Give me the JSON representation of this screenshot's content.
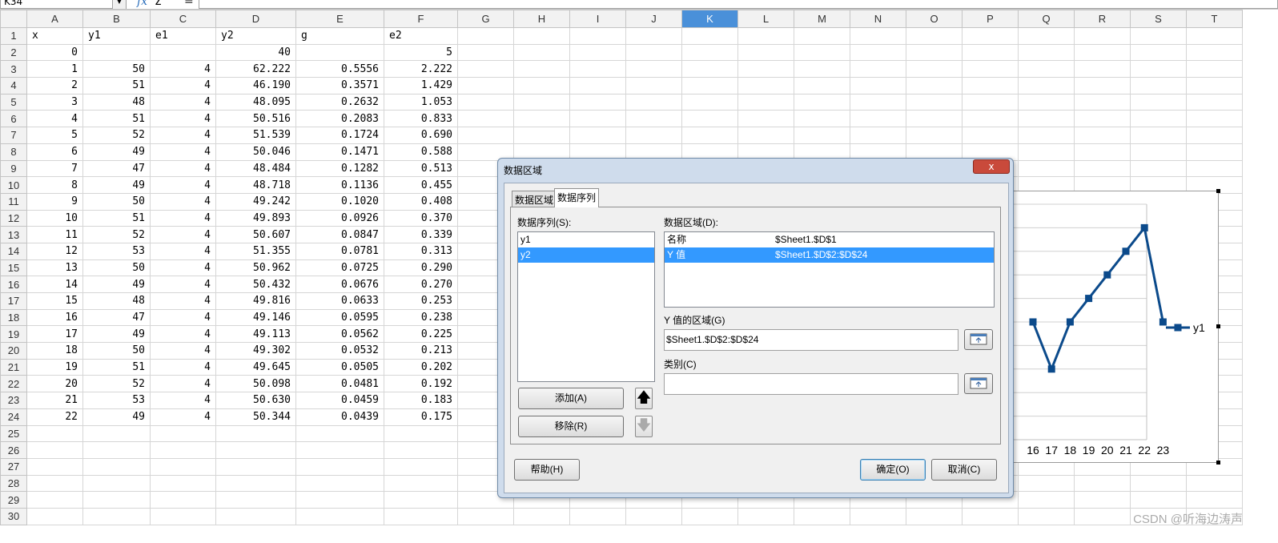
{
  "formula": {
    "cell_ref": "K34",
    "fx": "fx",
    "sum": "Σ",
    "eq": "="
  },
  "sheet": {
    "columns": [
      "A",
      "B",
      "C",
      "D",
      "E",
      "F",
      "G",
      "H",
      "I",
      "J",
      "K",
      "L",
      "M",
      "N",
      "O",
      "P",
      "Q",
      "R",
      "S",
      "T"
    ],
    "active_column": "K",
    "headers": [
      "x",
      "y1",
      "e1",
      "y2",
      "g",
      "e2"
    ],
    "row2": {
      "x": "0",
      "y2": "40",
      "e2": "5"
    },
    "rows": [
      [
        "1",
        "50",
        "4",
        "62.222",
        "0.5556",
        "2.222"
      ],
      [
        "2",
        "51",
        "4",
        "46.190",
        "0.3571",
        "1.429"
      ],
      [
        "3",
        "48",
        "4",
        "48.095",
        "0.2632",
        "1.053"
      ],
      [
        "4",
        "51",
        "4",
        "50.516",
        "0.2083",
        "0.833"
      ],
      [
        "5",
        "52",
        "4",
        "51.539",
        "0.1724",
        "0.690"
      ],
      [
        "6",
        "49",
        "4",
        "50.046",
        "0.1471",
        "0.588"
      ],
      [
        "7",
        "47",
        "4",
        "48.484",
        "0.1282",
        "0.513"
      ],
      [
        "8",
        "49",
        "4",
        "48.718",
        "0.1136",
        "0.455"
      ],
      [
        "9",
        "50",
        "4",
        "49.242",
        "0.1020",
        "0.408"
      ],
      [
        "10",
        "51",
        "4",
        "49.893",
        "0.0926",
        "0.370"
      ],
      [
        "11",
        "52",
        "4",
        "50.607",
        "0.0847",
        "0.339"
      ],
      [
        "12",
        "53",
        "4",
        "51.355",
        "0.0781",
        "0.313"
      ],
      [
        "13",
        "50",
        "4",
        "50.962",
        "0.0725",
        "0.290"
      ],
      [
        "14",
        "49",
        "4",
        "50.432",
        "0.0676",
        "0.270"
      ],
      [
        "15",
        "48",
        "4",
        "49.816",
        "0.0633",
        "0.253"
      ],
      [
        "16",
        "47",
        "4",
        "49.146",
        "0.0595",
        "0.238"
      ],
      [
        "17",
        "49",
        "4",
        "49.113",
        "0.0562",
        "0.225"
      ],
      [
        "18",
        "50",
        "4",
        "49.302",
        "0.0532",
        "0.213"
      ],
      [
        "19",
        "51",
        "4",
        "49.645",
        "0.0505",
        "0.202"
      ],
      [
        "20",
        "52",
        "4",
        "50.098",
        "0.0481",
        "0.192"
      ],
      [
        "21",
        "53",
        "4",
        "50.630",
        "0.0459",
        "0.183"
      ],
      [
        "22",
        "49",
        "4",
        "50.344",
        "0.0439",
        "0.175"
      ]
    ],
    "row_numbers": [
      "1",
      "2",
      "3",
      "4",
      "5",
      "6",
      "7",
      "8",
      "9",
      "10",
      "11",
      "12",
      "13",
      "14",
      "15",
      "16",
      "17",
      "18",
      "19",
      "20",
      "21",
      "22",
      "23",
      "24",
      "25",
      "26",
      "27",
      "28",
      "29",
      "30"
    ]
  },
  "chart_data": {
    "type": "line",
    "x": [
      "16",
      "17",
      "18",
      "19",
      "20",
      "21",
      "22",
      "23"
    ],
    "series": [
      {
        "name": "y1",
        "values": [
          49,
          47,
          49,
          50,
          51,
          52,
          53,
          49
        ]
      }
    ],
    "legend": "right",
    "color": "#0b4a8b",
    "ylim": [
      44,
      54
    ],
    "grid": true
  },
  "dialog": {
    "title": "数据区域",
    "close": "x",
    "tabs": [
      "数据区域",
      "数据序列"
    ],
    "series_label": "数据序列(S):",
    "series_label_key": "S",
    "series_items": [
      "y1",
      "y2"
    ],
    "selected_series": "y2",
    "range_label": "数据区域(D):",
    "range_rows": [
      {
        "name": "名称",
        "value": "$Sheet1.$D$1"
      },
      {
        "name": "Y 值",
        "value": "$Sheet1.$D$2:$D$24"
      }
    ],
    "y_range_label": "Y 值的区域(G)",
    "y_range_value": "$Sheet1.$D$2:$D$24",
    "category_label": "类别(C)",
    "category_value": "",
    "add_button": "添加(A)",
    "remove_button": "移除(R)",
    "help_button": "帮助(H)",
    "ok_button": "确定(O)",
    "cancel_button": "取消(C)"
  },
  "watermark": "CSDN @听海边涛声"
}
